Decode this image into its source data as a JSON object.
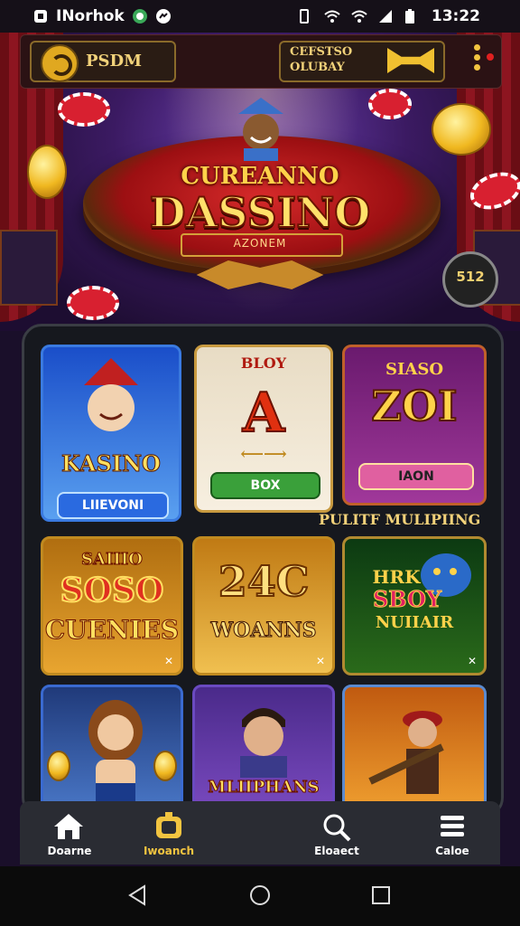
{
  "status_bar": {
    "app_name": "INorhok",
    "time": "13:22"
  },
  "top_bar": {
    "back_label": "PSDM",
    "club_label_line1": "CEFSTSO",
    "club_label_line2": "OLUBAY"
  },
  "hero": {
    "title_line1": "CUREANNO",
    "title_line2": "DASSINO",
    "subtitle": "AZONEM"
  },
  "badge": "512",
  "games": [
    {
      "title": "KASINO",
      "button": "LIIEVONI",
      "colors": [
        "#1a4ec9",
        "#5aa0f0"
      ]
    },
    {
      "header": "BLOY",
      "title": "A",
      "button": "BOX",
      "colors": [
        "#e8dcc4",
        "#f7efe0"
      ]
    },
    {
      "header": "SIASO",
      "title": "ZOI",
      "button": "IAON",
      "colors": [
        "#6a1a6e",
        "#a0389a"
      ]
    },
    {
      "title_line1": "SAIIIO",
      "title_line2": "SOSO",
      "title_line3": "CUENIES",
      "colors": [
        "#b06e10",
        "#e8a530"
      ]
    },
    {
      "title_line1": "24C",
      "title_line2": "WOANNS",
      "colors": [
        "#c07a14",
        "#f0c050"
      ]
    },
    {
      "title_line1": "HRK",
      "title_line2": "SBOY",
      "title_line3": "NUIIAIR",
      "colors": [
        "#0c3a12",
        "#2a6a1a"
      ]
    },
    {
      "title": "",
      "colors": [
        "#203a7a",
        "#4a78c8"
      ]
    },
    {
      "title": "MLIIPHANS",
      "colors": [
        "#4a2a8a",
        "#7a4ac0"
      ]
    },
    {
      "title": "",
      "colors": [
        "#c05a10",
        "#f0a030"
      ]
    }
  ],
  "section_label": "PULITF MULIPIING",
  "bottom_nav": [
    {
      "label": "Doarne",
      "icon": "home-icon",
      "active": false
    },
    {
      "label": "Iwoanch",
      "icon": "wallet-icon",
      "active": true
    },
    {
      "label": "Eloaect",
      "icon": "search-icon",
      "active": false
    },
    {
      "label": "Caloe",
      "icon": "menu-icon",
      "active": false
    }
  ],
  "colors": {
    "accent": "#f2c440",
    "active_nav": "#f2c440"
  }
}
